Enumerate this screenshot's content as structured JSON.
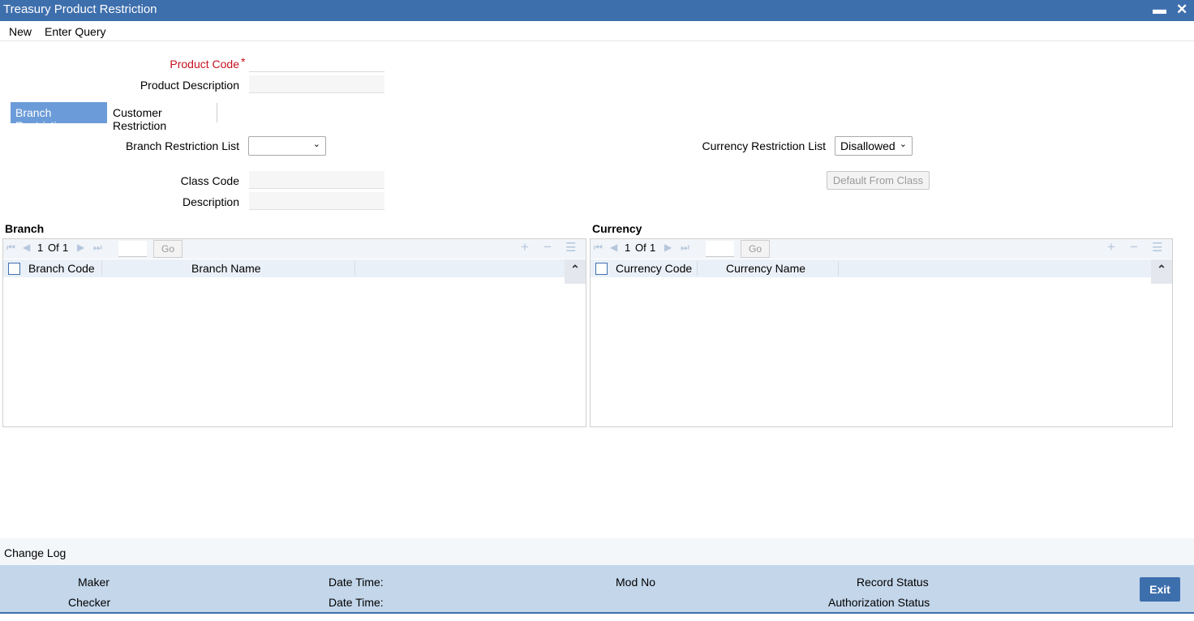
{
  "window": {
    "title": "Treasury Product Restriction",
    "minimize_icon": "minimize-icon",
    "close_icon": "close-icon"
  },
  "menu": {
    "new": "New",
    "enter_query": "Enter Query"
  },
  "form": {
    "product_code_label": "Product Code",
    "required_marker": "*",
    "product_code_value": "",
    "product_description_label": "Product Description",
    "product_description_value": ""
  },
  "tabs": [
    {
      "label": "Branch Restriction",
      "active": true
    },
    {
      "label": "Customer Restriction",
      "active": false
    }
  ],
  "branch_restriction": {
    "branch_list_label": "Branch Restriction List",
    "branch_list_value": "",
    "currency_list_label": "Currency Restriction List",
    "currency_list_value": "Disallowed",
    "class_code_label": "Class Code",
    "class_code_value": "",
    "description_label": "Description",
    "description_value": "",
    "default_button": "Default From Class"
  },
  "branch_grid": {
    "title": "Branch",
    "page": "1",
    "of_label": "Of",
    "total": "1",
    "go": "Go",
    "columns": [
      "Branch Code",
      "Branch Name"
    ],
    "rows": []
  },
  "currency_grid": {
    "title": "Currency",
    "page": "1",
    "of_label": "Of",
    "total": "1",
    "go": "Go",
    "columns": [
      "Currency Code",
      "Currency Name"
    ],
    "rows": []
  },
  "change_log": "Change Log",
  "footer": {
    "maker": "Maker",
    "checker": "Checker",
    "date_time_1": "Date Time:",
    "date_time_2": "Date Time:",
    "mod_no": "Mod No",
    "record_status": "Record Status",
    "authorization_status": "Authorization Status",
    "exit": "Exit"
  }
}
